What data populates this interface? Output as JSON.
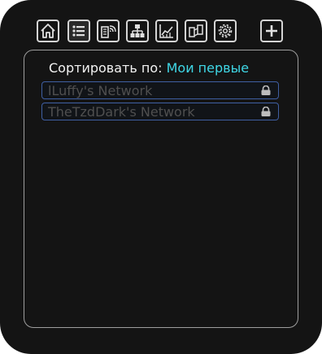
{
  "toolbar": {
    "buttons": [
      {
        "icon": "home-icon",
        "active": false
      },
      {
        "icon": "list-icon",
        "active": true
      },
      {
        "icon": "server-wifi-icon",
        "active": false
      },
      {
        "icon": "network-tree-icon",
        "active": false
      },
      {
        "icon": "chart-icon",
        "active": false
      },
      {
        "icon": "transfer-icon",
        "active": false
      },
      {
        "icon": "gear-icon",
        "active": false
      },
      {
        "icon": "plus-icon",
        "active": false
      }
    ]
  },
  "sort": {
    "label": "Сортировать по:",
    "value": "Мои первые"
  },
  "networks": [
    {
      "name": "lLuffy's Network",
      "locked": true
    },
    {
      "name": "TheTzdDark's Network",
      "locked": true
    }
  ],
  "colors": {
    "accent": "#3fd7e6",
    "row_border": "#3f5fa2",
    "muted_text": "#4f4f4f"
  }
}
